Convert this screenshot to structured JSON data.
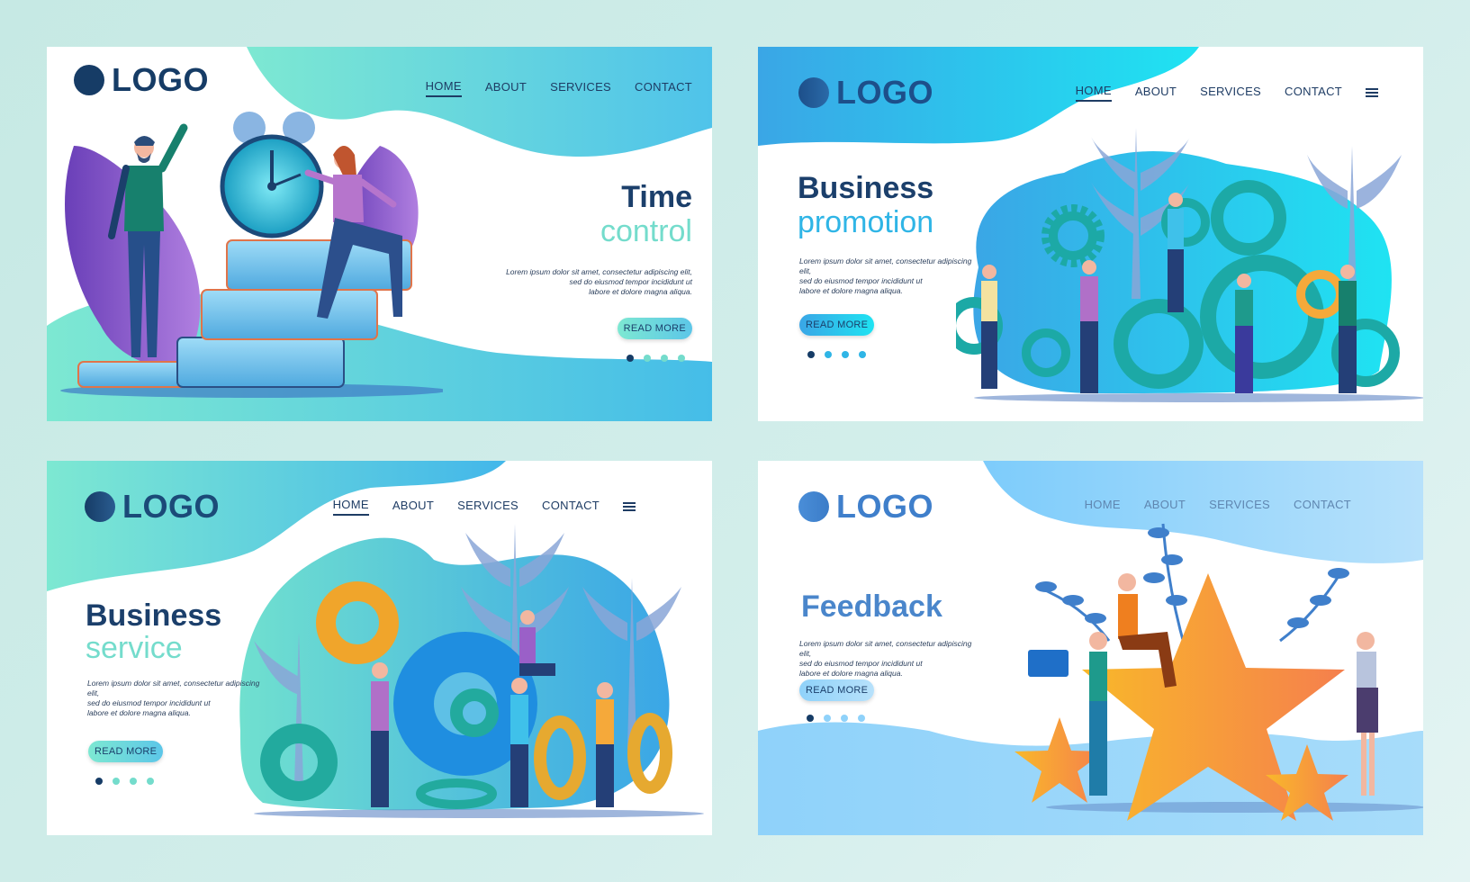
{
  "colors": {
    "page_background": "#c9e9e6",
    "navy": "#1b3f6b",
    "teal": "#6fe0cf",
    "cyan": "#22d3ee",
    "blue": "#3fa4e8",
    "light_blue": "#8fd2fa",
    "purple": "#8e5bc9",
    "orange": "#f6a43a"
  },
  "panels": [
    {
      "id": "time-control",
      "logo": "LOGO",
      "nav": {
        "items": [
          "HOME",
          "ABOUT",
          "SERVICES",
          "CONTACT"
        ],
        "active": "HOME",
        "has_menu_icon": false
      },
      "title_line1": "Time",
      "title_line2": "control",
      "description": [
        "Lorem ipsum dolor sit amet, consectetur adipiscing elit,",
        "sed do eiusmod tempor incididunt ut",
        "labore et dolore magna aliqua."
      ],
      "button": "READ MORE",
      "slides": {
        "total": 4,
        "active": 1
      },
      "illustration": [
        "man-figure-icon",
        "alarm-clock-icon",
        "book-stack-icon",
        "woman-figure-icon",
        "purple-leaf-icon"
      ]
    },
    {
      "id": "business-promotion",
      "logo": "LOGO",
      "nav": {
        "items": [
          "HOME",
          "ABOUT",
          "SERVICES",
          "CONTACT"
        ],
        "active": "HOME",
        "has_menu_icon": true
      },
      "title_line1": "Business",
      "title_line2": "promotion",
      "description": [
        "Lorem ipsum dolor sit amet, consectetur adipiscing elit,",
        "sed do eiusmod tempor incididunt ut",
        "labore et dolore magna aliqua."
      ],
      "button": "READ MORE",
      "slides": {
        "total": 4,
        "active": 1
      },
      "illustration": [
        "gear-icon",
        "people-team-icon",
        "palm-leaf-icon"
      ]
    },
    {
      "id": "business-service",
      "logo": "LOGO",
      "nav": {
        "items": [
          "HOME",
          "ABOUT",
          "SERVICES",
          "CONTACT"
        ],
        "active": "HOME",
        "has_menu_icon": true
      },
      "title_line1": "Business",
      "title_line2": "service",
      "description": [
        "Lorem ipsum dolor sit amet, consectetur adipiscing elit,",
        "sed do eiusmod tempor incididunt ut",
        "labore et dolore magna aliqua."
      ],
      "button": "READ MORE",
      "slides": {
        "total": 4,
        "active": 1
      },
      "illustration": [
        "gear-icon",
        "people-team-icon",
        "palm-leaf-icon"
      ]
    },
    {
      "id": "feedback",
      "logo": "LOGO",
      "nav": {
        "items": [
          "HOME",
          "ABOUT",
          "SERVICES",
          "CONTACT"
        ],
        "active": null,
        "has_menu_icon": false
      },
      "title_line1": "Feedback",
      "title_line2": "",
      "description": [
        "Lorem ipsum dolor sit amet, consectetur adipiscing elit,",
        "sed do eiusmod tempor incididunt ut",
        "labore et dolore magna aliqua."
      ],
      "button": "READ MORE",
      "slides": {
        "total": 4,
        "active": 1
      },
      "illustration": [
        "star-icon",
        "laptop-icon",
        "women-figures-icon",
        "branch-icon"
      ]
    }
  ]
}
